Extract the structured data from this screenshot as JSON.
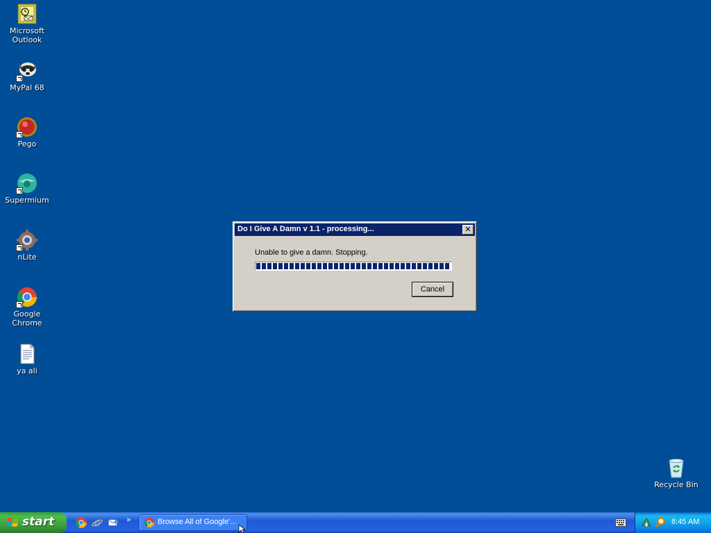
{
  "desktop": {
    "background_color": "#004e98",
    "icons": [
      {
        "label": "Microsoft Outlook",
        "icon": "outlook-icon",
        "shortcut": false
      },
      {
        "label": "MyPal 68",
        "icon": "mypal-icon",
        "shortcut": true
      },
      {
        "label": "Pego",
        "icon": "pego-icon",
        "shortcut": true
      },
      {
        "label": "Supermium",
        "icon": "supermium-icon",
        "shortcut": true
      },
      {
        "label": "nLite",
        "icon": "nlite-icon",
        "shortcut": true
      },
      {
        "label": "Google Chrome",
        "icon": "chrome-icon",
        "shortcut": true
      },
      {
        "label": "ya ali",
        "icon": "text-document-icon",
        "shortcut": false
      },
      {
        "label": "Recycle Bin",
        "icon": "recycle-bin-icon",
        "shortcut": false
      }
    ]
  },
  "dialog": {
    "title": "Do I Give A Damn v 1.1 - processing...",
    "message": "Unable to give a damn. Stopping.",
    "progress_percent": 100,
    "cancel_label": "Cancel",
    "close_glyph": "✕",
    "titlebar_color": "#0a246a",
    "progress_color": "#0a246a"
  },
  "taskbar": {
    "start_label": "start",
    "quicklaunch": [
      "chrome-icon",
      "internet-explorer-icon",
      "outlook-express-icon"
    ],
    "chevron": "»",
    "task_button": {
      "label": "Browse All of Google'...",
      "icon": "chrome-icon"
    },
    "tray": {
      "icons": [
        "network-icon",
        "search-icon"
      ],
      "clock": "8:45 AM"
    }
  }
}
